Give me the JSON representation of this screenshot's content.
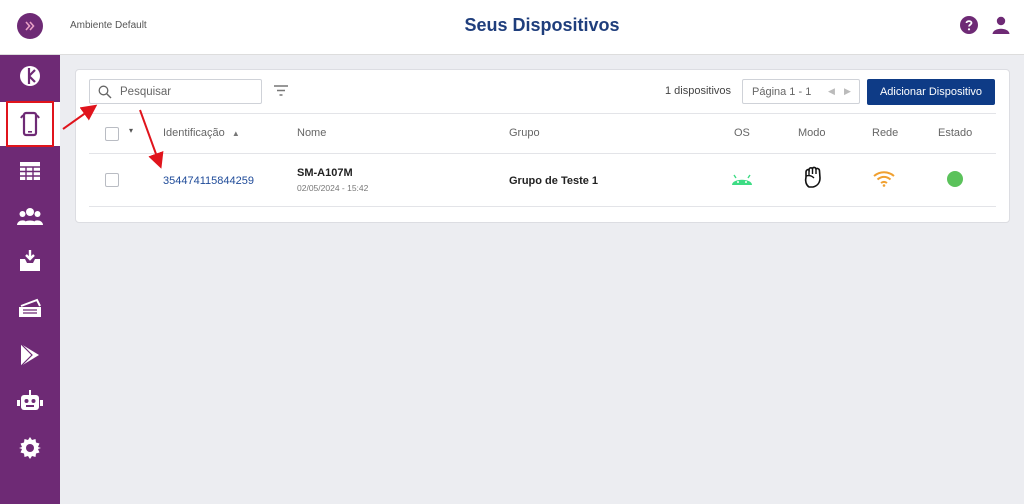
{
  "header": {
    "environment": "Ambiente Default",
    "title": "Seus Dispositivos"
  },
  "sidebar": {
    "items": [
      {
        "icon": "dashboard-icon"
      },
      {
        "icon": "devices-icon",
        "active": true
      },
      {
        "icon": "grid-table-icon"
      },
      {
        "icon": "groups-icon"
      },
      {
        "icon": "inbox-download-icon"
      },
      {
        "icon": "stacked-cards-icon"
      },
      {
        "icon": "play-store-icon"
      },
      {
        "icon": "robot-icon"
      },
      {
        "icon": "gear-icon"
      }
    ]
  },
  "toolbar": {
    "search_placeholder": "Pesquisar",
    "count_text": "1 dispositivos",
    "pager_text": "Página 1 - 1",
    "add_button": "Adicionar Dispositivo"
  },
  "table": {
    "columns": [
      "Identificação",
      "Nome",
      "Grupo",
      "OS",
      "Modo",
      "Rede",
      "Estado"
    ],
    "rows": [
      {
        "id": "354474115844259",
        "name": "SM-A107M",
        "date": "02/05/2024 - 15:42",
        "group": "Grupo de Teste 1",
        "os": "android",
        "mode": "fist",
        "network": "wifi",
        "state": "online"
      }
    ]
  },
  "colors": {
    "sidebar": "#6e2a75",
    "title": "#1f3e7c",
    "button": "#0e3b86",
    "link": "#1f4b99",
    "online": "#5bc25b",
    "android": "#3ddc84",
    "wifi": "#f0a030",
    "annotation": "#e0141c"
  }
}
